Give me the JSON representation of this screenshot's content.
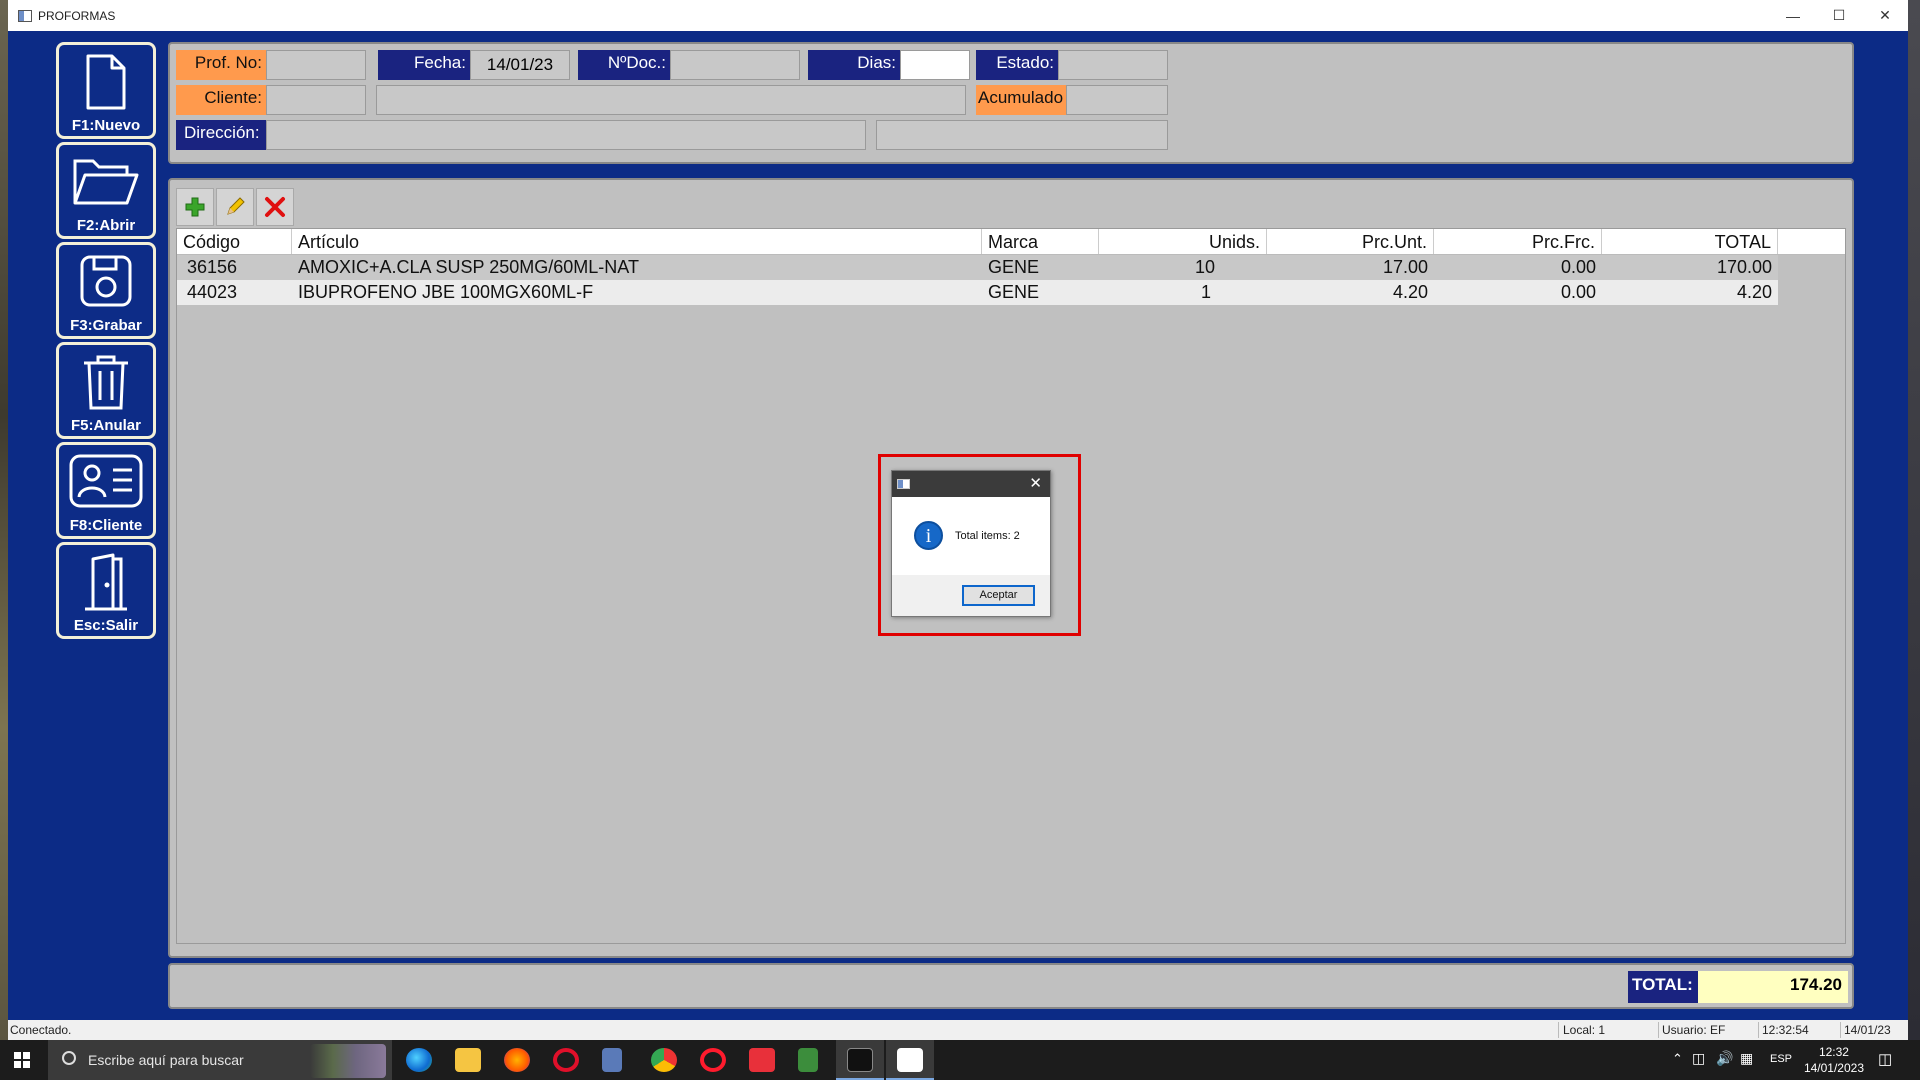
{
  "window": {
    "title": "PROFORMAS"
  },
  "sidebar": [
    {
      "key": "new",
      "label": "F1:Nuevo",
      "icon": "document-icon"
    },
    {
      "key": "open",
      "label": "F2:Abrir",
      "icon": "folder-open-icon"
    },
    {
      "key": "save",
      "label": "F3:Grabar",
      "icon": "floppy-disk-icon"
    },
    {
      "key": "cancel",
      "label": "F5:Anular",
      "icon": "trash-icon"
    },
    {
      "key": "client",
      "label": "F8:Cliente",
      "icon": "contact-card-icon"
    },
    {
      "key": "exit",
      "label": "Esc:Salir",
      "icon": "exit-door-icon"
    }
  ],
  "header": {
    "prof_no_label": "Prof. No:",
    "prof_no_value": "",
    "fecha_label": "Fecha:",
    "fecha_value": "14/01/23",
    "ndoc_label": "NºDoc.:",
    "ndoc_value": "",
    "dias_label": "Dias:",
    "dias_value": "",
    "estado_label": "Estado:",
    "estado_value": "",
    "cliente_label": "Cliente:",
    "cliente_code": "",
    "cliente_name": "",
    "acumulado_label": "Acumulado",
    "acumulado_value": "",
    "direccion_label": "Dirección:",
    "direccion_value": "",
    "direccion_extra": ""
  },
  "toolbar": {
    "add_icon": "plus-icon",
    "edit_icon": "pencil-icon",
    "delete_icon": "delete-x-icon"
  },
  "grid": {
    "columns": [
      "Código",
      "Artículo",
      "Marca",
      "Unids.",
      "Prc.Unt.",
      "Prc.Frc.",
      "TOTAL"
    ],
    "rows": [
      [
        "36156",
        "AMOXIC+A.CLA SUSP 250MG/60ML-NAT",
        "GENE",
        "10",
        "17.00",
        "0.00",
        "170.00"
      ],
      [
        "44023",
        "IBUPROFENO JBE 100MGX60ML-F",
        "GENE",
        "1",
        "4.20",
        "0.00",
        "4.20"
      ]
    ]
  },
  "footer": {
    "total_label": "TOTAL:",
    "total_value": "174.20"
  },
  "status": {
    "connection": "Conectado.",
    "local": "Local: 1",
    "user": "Usuario: EF",
    "time": "12:32:54",
    "date": "14/01/23"
  },
  "dialog": {
    "message": "Total items: 2",
    "ok_label": "Aceptar",
    "icon": "info-icon"
  },
  "taskbar": {
    "search_placeholder": "Escribe aquí para buscar",
    "lang": "ESP",
    "clock_time": "12:32",
    "clock_date": "14/01/2023"
  },
  "colors": {
    "navy": "#1a2380",
    "orange": "#ff9a4d",
    "panel": "#c0c0c0",
    "total_bg": "#ffffc0",
    "highlight": "#e00000"
  }
}
